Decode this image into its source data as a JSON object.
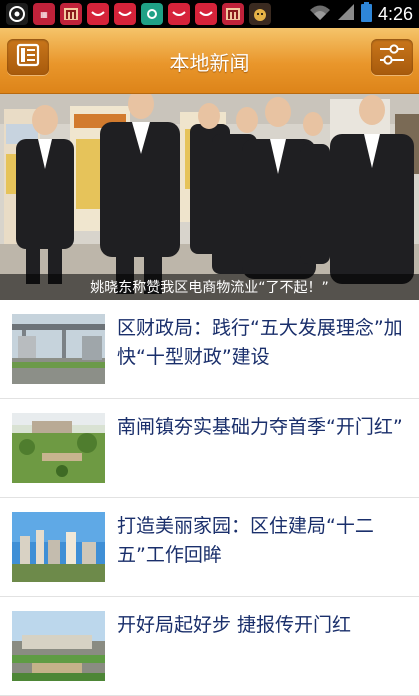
{
  "status_bar": {
    "time": "4:26",
    "notification_icons": [
      "app-icon",
      "gift-icon",
      "app-icon",
      "gift-icon",
      "gift-icon",
      "link-icon",
      "gift-icon",
      "gift-icon",
      "app-icon",
      "app-icon"
    ],
    "system_icons": [
      "wifi-icon",
      "signal-icon",
      "battery-icon"
    ]
  },
  "header": {
    "title": "本地新闻",
    "left_button_icon": "list-icon",
    "right_button_icon": "settings-sliders-icon"
  },
  "hero": {
    "caption": "姚晓东称赞我区电商物流业“了不起！”"
  },
  "news": [
    {
      "title": "区财政局：践行“五大发展理念”加快“十型财政”建设"
    },
    {
      "title": "南闸镇夯实基础力夺首季“开门红”"
    },
    {
      "title": "打造美丽家园：区住建局“十二五”工作回眸"
    },
    {
      "title": "开好局起好步 捷报传开门红"
    }
  ]
}
